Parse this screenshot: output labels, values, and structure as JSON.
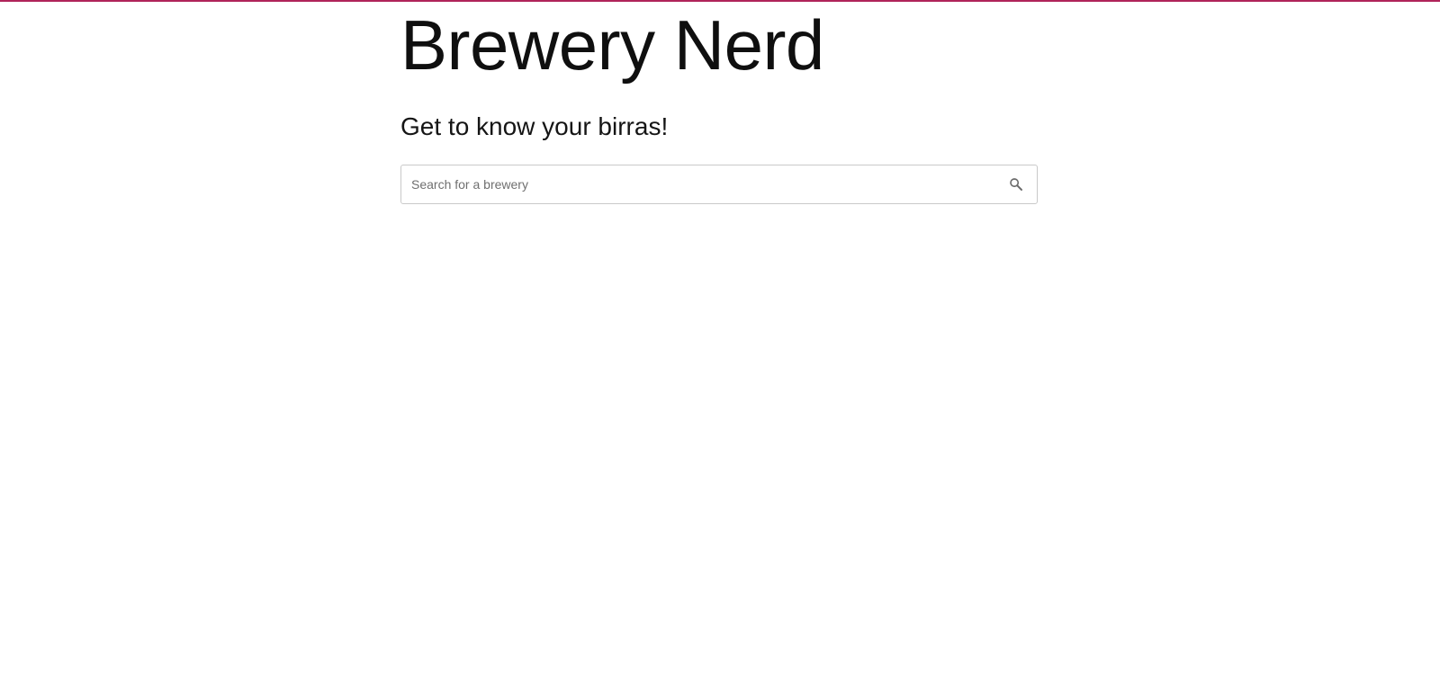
{
  "header": {
    "title": "Brewery Nerd",
    "subtitle": "Get to know your birras!"
  },
  "search": {
    "placeholder": "Search for a brewery",
    "value": "",
    "icon": "search-icon"
  },
  "colors": {
    "accent_bar": "#b0245a",
    "background": "#ffffff",
    "search_icon": "#6b6b6b"
  }
}
